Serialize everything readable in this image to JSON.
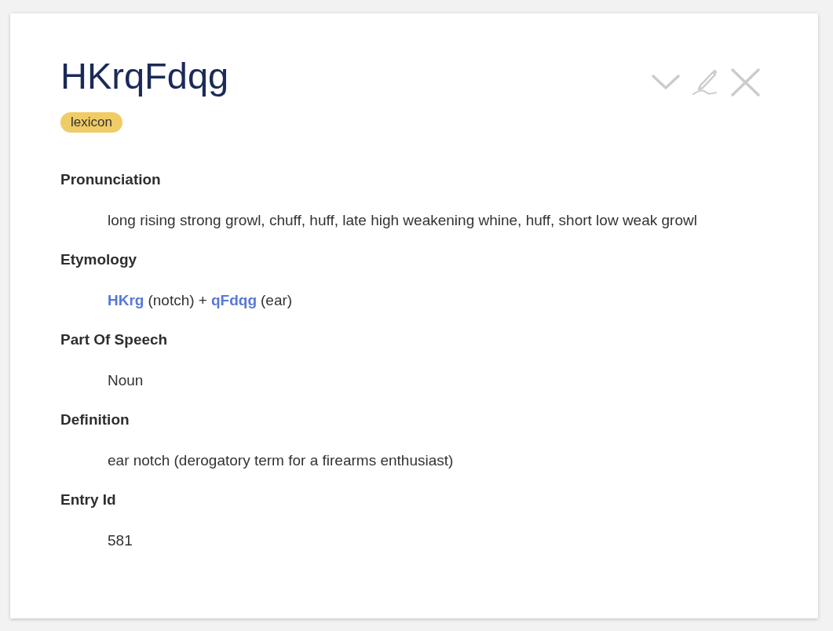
{
  "entry": {
    "title": "HKrqFdqg",
    "tag": "lexicon"
  },
  "actions": [
    {
      "kind": "collapse"
    },
    {
      "kind": "edit"
    },
    {
      "kind": "close"
    }
  ],
  "fields": [
    {
      "kind": "text",
      "heading": "Pronunciation",
      "value": "long rising strong growl, chuff, huff, late high weakening whine, huff, short low weak growl"
    },
    {
      "kind": "etymology",
      "heading": "Etymology",
      "segments": [
        {
          "kind": "link",
          "text": "HKrg"
        },
        {
          "kind": "text",
          "text": "(notch) +"
        },
        {
          "kind": "link",
          "text": "qFdqg"
        },
        {
          "kind": "text",
          "text": "(ear)"
        }
      ]
    },
    {
      "kind": "text",
      "heading": "Part Of Speech",
      "value": "Noun"
    },
    {
      "kind": "text",
      "heading": "Definition",
      "value": "ear notch (derogatory term for a firearms enthusiast)"
    },
    {
      "kind": "text",
      "heading": "Entry Id",
      "value": "581"
    }
  ]
}
